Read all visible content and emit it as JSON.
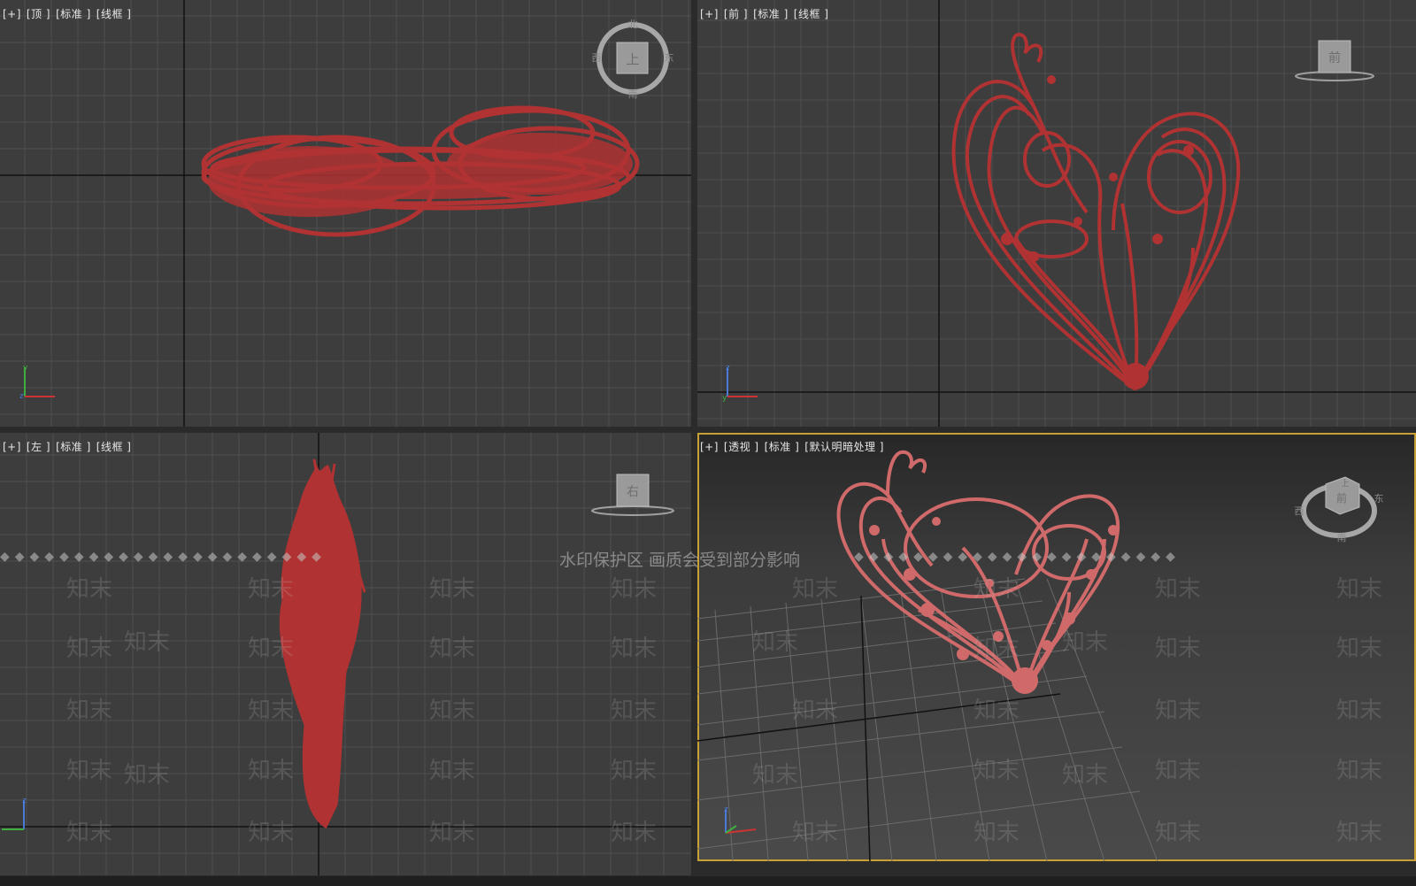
{
  "viewports": [
    {
      "id": "top",
      "labels": [
        "[+]",
        "[顶 ]",
        "[标准 ]",
        "[线框 ]"
      ],
      "view_cube_face": "上",
      "compass": {
        "n": "北",
        "s": "南",
        "e": "东",
        "w": "西"
      }
    },
    {
      "id": "front",
      "labels": [
        "[+]",
        "[前 ]",
        "[标准 ]",
        "[线框 ]"
      ],
      "view_cube_face": "前"
    },
    {
      "id": "left",
      "labels": [
        "[+]",
        "[左 ]",
        "[标准 ]",
        "[线框 ]"
      ],
      "view_cube_face": "右"
    },
    {
      "id": "perspective",
      "labels": [
        "[+]",
        "[透视 ]",
        "[标准 ]",
        "[默认明暗处理 ]"
      ],
      "view_cube_face": "前",
      "view_cube_top": "上",
      "compass": {
        "s": "南",
        "e": "东",
        "w": "西"
      },
      "active": true
    }
  ],
  "watermark": {
    "band_text": "水印保护区   画质会受到部分影响",
    "mark": "知末"
  },
  "colors": {
    "viewport_bg": "#3d3d3d",
    "grid": "#545454",
    "model": "#b03232",
    "model_shaded": "#d06a6a",
    "active_border": "#c8a036"
  }
}
